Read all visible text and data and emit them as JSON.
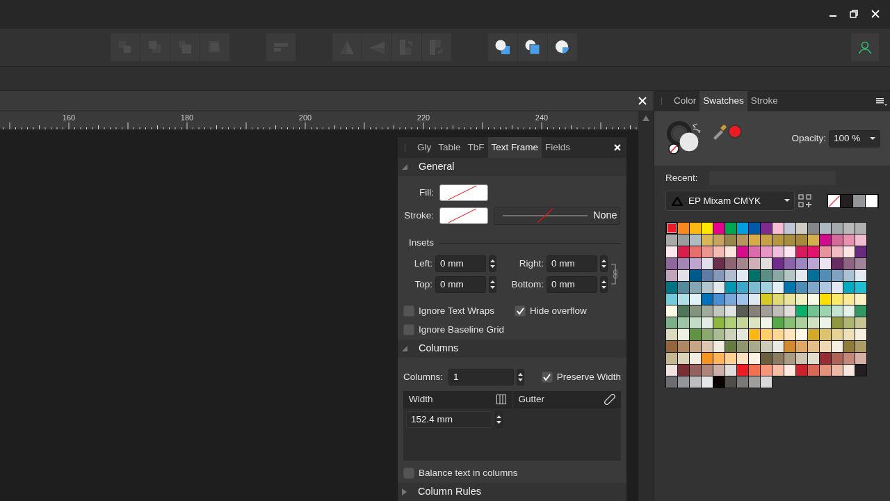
{
  "toolbar": {
    "groups": [
      {
        "buttons": [
          {
            "kind": "bring-to-front",
            "disabled": true
          },
          {
            "kind": "bring-forward",
            "disabled": true
          },
          {
            "kind": "send-backward",
            "disabled": true
          },
          {
            "kind": "send-to-back",
            "disabled": true
          }
        ]
      },
      {
        "buttons": [
          {
            "kind": "align",
            "disabled": true
          }
        ]
      },
      {
        "buttons": [
          {
            "kind": "flip-horizontal",
            "disabled": true
          },
          {
            "kind": "flip-vertical",
            "disabled": true
          },
          {
            "kind": "rotate-left",
            "disabled": true
          },
          {
            "kind": "rotate-right",
            "disabled": true
          }
        ]
      },
      {
        "buttons": [
          {
            "kind": "add",
            "disabled": false
          },
          {
            "kind": "subtract",
            "disabled": false
          },
          {
            "kind": "intersect",
            "disabled": false
          }
        ]
      }
    ]
  },
  "ruler": {
    "labels": [
      "160",
      "180",
      "200",
      "220",
      "240"
    ]
  },
  "text_frame_panel": {
    "tabs": [
      {
        "label": "Gly",
        "selected": false
      },
      {
        "label": "Table",
        "selected": false
      },
      {
        "label": "TbF",
        "selected": false
      },
      {
        "label": "Text Frame",
        "selected": true
      },
      {
        "label": "Fields",
        "selected": false
      }
    ],
    "general": {
      "title": "General",
      "expanded": true,
      "fill_label": "Fill:",
      "stroke_label": "Stroke:",
      "stroke_style": "None",
      "insets_title": "Insets",
      "insets": [
        {
          "label": "Left:",
          "value": "0 mm"
        },
        {
          "label": "Right:",
          "value": "0 mm"
        },
        {
          "label": "Top:",
          "value": "0 mm"
        },
        {
          "label": "Bottom:",
          "value": "0 mm"
        }
      ],
      "options": [
        {
          "label": "Ignore Text Wraps",
          "checked": false
        },
        {
          "label": "Hide overflow",
          "checked": true
        },
        {
          "label": "Ignore Baseline Grid",
          "checked": false
        }
      ]
    },
    "columns": {
      "title": "Columns",
      "expanded": true,
      "count_label": "Columns:",
      "count": "1",
      "preserve_width": {
        "label": "Preserve Width",
        "checked": true
      },
      "table": {
        "columns": [
          "Width",
          "Gutter"
        ],
        "rows": [
          {
            "width": "152.4 mm"
          }
        ]
      },
      "balance": {
        "label": "Balance text in columns",
        "checked": false
      }
    },
    "column_rules": {
      "title": "Column Rules",
      "expanded": false
    }
  },
  "swatches_panel": {
    "tabs": [
      {
        "label": "Color",
        "selected": false
      },
      {
        "label": "Swatches",
        "selected": true
      },
      {
        "label": "Stroke",
        "selected": false
      }
    ],
    "opacity": {
      "label": "Opacity:",
      "value": "100 %"
    },
    "recent": {
      "label": "Recent:"
    },
    "palette": {
      "name": "EP Mixam CMYK"
    },
    "quick_swatches": [
      {
        "kind": "none"
      },
      {
        "kind": "color",
        "color": "#231f20"
      },
      {
        "kind": "color",
        "color": "#939598"
      },
      {
        "kind": "color",
        "color": "#ffffff"
      }
    ],
    "swatch_rows": [
      {
        "swatches": [
          {
            "color": "#ed1c24",
            "selected": true
          },
          {
            "color": "#f7891f",
            "selected": false
          },
          {
            "color": "#fdb813",
            "selected": false
          },
          {
            "color": "#ffe600",
            "selected": false
          },
          {
            "color": "#e0078c",
            "selected": false
          },
          {
            "color": "#00a650",
            "selected": false
          },
          {
            "color": "#009fe0",
            "selected": false
          },
          {
            "color": "#0058a8",
            "selected": false
          },
          {
            "color": "#7f2a8e",
            "selected": false
          },
          {
            "color": "#f7bcd6",
            "selected": false
          },
          {
            "color": "#c0c6d6",
            "selected": false
          },
          {
            "color": "#d0ccc4",
            "selected": false
          },
          {
            "color": "#85868a",
            "selected": false
          },
          {
            "color": "#adb9c1",
            "selected": false
          },
          {
            "color": "#a4a9ab",
            "selected": false
          },
          {
            "color": "#b9b9b9",
            "selected": false
          },
          {
            "color": "#b0b0b0",
            "selected": false
          }
        ]
      },
      {
        "swatches": [
          {
            "color": "#a9a9a9",
            "selected": false
          },
          {
            "color": "#9c9c9c",
            "selected": false
          },
          {
            "color": "#aebbc2",
            "selected": false
          },
          {
            "color": "#dcb654",
            "selected": false
          },
          {
            "color": "#c6a45e",
            "selected": false
          },
          {
            "color": "#98864b",
            "selected": false
          },
          {
            "color": "#b5965c",
            "selected": false
          },
          {
            "color": "#d9ab48",
            "selected": false
          },
          {
            "color": "#c6a244",
            "selected": false
          },
          {
            "color": "#b59741",
            "selected": false
          },
          {
            "color": "#a88c3f",
            "selected": false
          },
          {
            "color": "#a8893a",
            "selected": false
          },
          {
            "color": "#d3b04e",
            "selected": false
          },
          {
            "color": "#d20a8d",
            "selected": false
          },
          {
            "color": "#d36c9a",
            "selected": false
          },
          {
            "color": "#e891b0",
            "selected": false
          },
          {
            "color": "#f1bdd0",
            "selected": false
          }
        ]
      },
      {
        "swatches": [
          {
            "color": "#fde8ef",
            "selected": false
          },
          {
            "color": "#da1e4b",
            "selected": false
          },
          {
            "color": "#e66f6f",
            "selected": false
          },
          {
            "color": "#eb958e",
            "selected": false
          },
          {
            "color": "#f3bdb5",
            "selected": false
          },
          {
            "color": "#fde6dd",
            "selected": false
          },
          {
            "color": "#d70c8c",
            "selected": false
          },
          {
            "color": "#dc6aac",
            "selected": false
          },
          {
            "color": "#e896c6",
            "selected": false
          },
          {
            "color": "#f0bfdb",
            "selected": false
          },
          {
            "color": "#fde8f2",
            "selected": false
          },
          {
            "color": "#d91b5c",
            "selected": false
          },
          {
            "color": "#e0156b",
            "selected": false
          },
          {
            "color": "#e8949e",
            "selected": false
          },
          {
            "color": "#f1bcc4",
            "selected": false
          },
          {
            "color": "#fde6e7",
            "selected": false
          },
          {
            "color": "#682c7e",
            "selected": false
          }
        ]
      },
      {
        "swatches": [
          {
            "color": "#8f679d",
            "selected": false
          },
          {
            "color": "#a386b6",
            "selected": false
          },
          {
            "color": "#bea5cd",
            "selected": false
          },
          {
            "color": "#e0dfeb",
            "selected": false
          },
          {
            "color": "#6a2f4c",
            "selected": false
          },
          {
            "color": "#8f6473",
            "selected": false
          },
          {
            "color": "#a5868c",
            "selected": false
          },
          {
            "color": "#ceb1b8",
            "selected": false
          },
          {
            "color": "#e1dddc",
            "selected": false
          },
          {
            "color": "#702b8d",
            "selected": false
          },
          {
            "color": "#8b63ab",
            "selected": false
          },
          {
            "color": "#9c88c0",
            "selected": false
          },
          {
            "color": "#bba6d3",
            "selected": false
          },
          {
            "color": "#ece3f2",
            "selected": false
          },
          {
            "color": "#672c63",
            "selected": false
          },
          {
            "color": "#8e6482",
            "selected": false
          },
          {
            "color": "#a08399",
            "selected": false
          }
        ]
      },
      {
        "swatches": [
          {
            "color": "#c1a4bb",
            "selected": false
          },
          {
            "color": "#e1dfe8",
            "selected": false
          },
          {
            "color": "#005a8c",
            "selected": false
          },
          {
            "color": "#5f7aa5",
            "selected": false
          },
          {
            "color": "#8698ba",
            "selected": false
          },
          {
            "color": "#b2bdd3",
            "selected": false
          },
          {
            "color": "#e3e9f2",
            "selected": false
          },
          {
            "color": "#007168",
            "selected": false
          },
          {
            "color": "#5b8e86",
            "selected": false
          },
          {
            "color": "#89a7a5",
            "selected": false
          },
          {
            "color": "#b4c5c6",
            "selected": false
          },
          {
            "color": "#e3e9ec",
            "selected": false
          },
          {
            "color": "#006f9a",
            "selected": false
          },
          {
            "color": "#4f8eb5",
            "selected": false
          },
          {
            "color": "#7ea3c0",
            "selected": false
          },
          {
            "color": "#adc1d4",
            "selected": false
          },
          {
            "color": "#e3eaf2",
            "selected": false
          }
        ]
      },
      {
        "swatches": [
          {
            "color": "#007384",
            "selected": false
          },
          {
            "color": "#538b9a",
            "selected": false
          },
          {
            "color": "#84a7b3",
            "selected": false
          },
          {
            "color": "#b1c6cd",
            "selected": false
          },
          {
            "color": "#e3eaee",
            "selected": false
          },
          {
            "color": "#0097b3",
            "selected": false
          },
          {
            "color": "#3ba8c7",
            "selected": false
          },
          {
            "color": "#7bbcd0",
            "selected": false
          },
          {
            "color": "#a3d1de",
            "selected": false
          },
          {
            "color": "#e2f0f5",
            "selected": false
          },
          {
            "color": "#0076ae",
            "selected": false
          },
          {
            "color": "#4c8cb7",
            "selected": false
          },
          {
            "color": "#7ea7ca",
            "selected": false
          },
          {
            "color": "#aec6df",
            "selected": false
          },
          {
            "color": "#e2e9f4",
            "selected": false
          },
          {
            "color": "#00aac0",
            "selected": false
          },
          {
            "color": "#1ec0d1",
            "selected": false
          }
        ]
      },
      {
        "swatches": [
          {
            "color": "#73cbd9",
            "selected": false
          },
          {
            "color": "#aee0e6",
            "selected": false
          },
          {
            "color": "#e2f3f7",
            "selected": false
          },
          {
            "color": "#0072bc",
            "selected": false
          },
          {
            "color": "#4a8fcf",
            "selected": false
          },
          {
            "color": "#7aa8da",
            "selected": false
          },
          {
            "color": "#a2c3e8",
            "selected": false
          },
          {
            "color": "#e0e8f6",
            "selected": false
          },
          {
            "color": "#d4cc24",
            "selected": false
          },
          {
            "color": "#e0dc72",
            "selected": false
          },
          {
            "color": "#ebe49c",
            "selected": false
          },
          {
            "color": "#f1eec2",
            "selected": false
          },
          {
            "color": "#fafbe6",
            "selected": false
          },
          {
            "color": "#ffdd00",
            "selected": false
          },
          {
            "color": "#fee96c",
            "selected": false
          },
          {
            "color": "#feea99",
            "selected": false
          },
          {
            "color": "#fff3c4",
            "selected": false
          }
        ]
      },
      {
        "swatches": [
          {
            "color": "#fffbe7",
            "selected": false
          },
          {
            "color": "#4e775a",
            "selected": false
          },
          {
            "color": "#83957f",
            "selected": false
          },
          {
            "color": "#a0ab9b",
            "selected": false
          },
          {
            "color": "#c2c8bf",
            "selected": false
          },
          {
            "color": "#e1e5df",
            "selected": false
          },
          {
            "color": "#595e55",
            "selected": false
          },
          {
            "color": "#878079",
            "selected": false
          },
          {
            "color": "#a29f98",
            "selected": false
          },
          {
            "color": "#c2bfb8",
            "selected": false
          },
          {
            "color": "#e1dedc",
            "selected": false
          },
          {
            "color": "#08b06a",
            "selected": false
          },
          {
            "color": "#72c394",
            "selected": false
          },
          {
            "color": "#9bd4ae",
            "selected": false
          },
          {
            "color": "#c3e4d0",
            "selected": false
          },
          {
            "color": "#e4f3e9",
            "selected": false
          },
          {
            "color": "#339862",
            "selected": false
          }
        ]
      },
      {
        "swatches": [
          {
            "color": "#7baf8b",
            "selected": false
          },
          {
            "color": "#9fc5a7",
            "selected": false
          },
          {
            "color": "#c3dcc8",
            "selected": false
          },
          {
            "color": "#e3ede5",
            "selected": false
          },
          {
            "color": "#8db73e",
            "selected": false
          },
          {
            "color": "#b0d076",
            "selected": false
          },
          {
            "color": "#c7d59c",
            "selected": false
          },
          {
            "color": "#dbe5c3",
            "selected": false
          },
          {
            "color": "#f1f6e9",
            "selected": false
          },
          {
            "color": "#57a846",
            "selected": false
          },
          {
            "color": "#88bf74",
            "selected": false
          },
          {
            "color": "#acd19a",
            "selected": false
          },
          {
            "color": "#d0e2c2",
            "selected": false
          },
          {
            "color": "#ecf3e8",
            "selected": false
          },
          {
            "color": "#8f973f",
            "selected": false
          },
          {
            "color": "#aeb56f",
            "selected": false
          },
          {
            "color": "#c5c693",
            "selected": false
          }
        ]
      },
      {
        "swatches": [
          {
            "color": "#dcd9bd",
            "selected": false
          },
          {
            "color": "#eef0e3",
            "selected": false
          },
          {
            "color": "#629344",
            "selected": false
          },
          {
            "color": "#8ba96d",
            "selected": false
          },
          {
            "color": "#abbb93",
            "selected": false
          },
          {
            "color": "#cdd3bb",
            "selected": false
          },
          {
            "color": "#e3e6dd",
            "selected": false
          },
          {
            "color": "#fdb714",
            "selected": false
          },
          {
            "color": "#fecf64",
            "selected": false
          },
          {
            "color": "#fed890",
            "selected": false
          },
          {
            "color": "#fee5bb",
            "selected": false
          },
          {
            "color": "#fef6e6",
            "selected": false
          },
          {
            "color": "#d3a929",
            "selected": false
          },
          {
            "color": "#ddc46c",
            "selected": false
          },
          {
            "color": "#e6d394",
            "selected": false
          },
          {
            "color": "#f0e0b7",
            "selected": false
          },
          {
            "color": "#f7efe0",
            "selected": false
          }
        ]
      },
      {
        "swatches": [
          {
            "color": "#95663c",
            "selected": false
          },
          {
            "color": "#b08763",
            "selected": false
          },
          {
            "color": "#c9a587",
            "selected": false
          },
          {
            "color": "#dcc5b1",
            "selected": false
          },
          {
            "color": "#f0ece3",
            "selected": false
          },
          {
            "color": "#677a42",
            "selected": false
          },
          {
            "color": "#8e9570",
            "selected": false
          },
          {
            "color": "#a9ac8b",
            "selected": false
          },
          {
            "color": "#ccccb9",
            "selected": false
          },
          {
            "color": "#e9e9e2",
            "selected": false
          },
          {
            "color": "#d38a2f",
            "selected": false
          },
          {
            "color": "#dea866",
            "selected": false
          },
          {
            "color": "#e5bd8b",
            "selected": false
          },
          {
            "color": "#f0d7b4",
            "selected": false
          },
          {
            "color": "#f7efe1",
            "selected": false
          },
          {
            "color": "#8f7c3a",
            "selected": false
          },
          {
            "color": "#ad9b68",
            "selected": false
          }
        ]
      },
      {
        "swatches": [
          {
            "color": "#c5b792",
            "selected": false
          },
          {
            "color": "#dcd2b7",
            "selected": false
          },
          {
            "color": "#f1ede2",
            "selected": false
          },
          {
            "color": "#f8931f",
            "selected": false
          },
          {
            "color": "#feb65b",
            "selected": false
          },
          {
            "color": "#fdd18e",
            "selected": false
          },
          {
            "color": "#fee1c1",
            "selected": false
          },
          {
            "color": "#fef2e5",
            "selected": false
          },
          {
            "color": "#6b5e3e",
            "selected": false
          },
          {
            "color": "#8c7c5f",
            "selected": false
          },
          {
            "color": "#aa9c84",
            "selected": false
          },
          {
            "color": "#cfc5b3",
            "selected": false
          },
          {
            "color": "#e3ddcf",
            "selected": false
          },
          {
            "color": "#962d32",
            "selected": false
          },
          {
            "color": "#ad6457",
            "selected": false
          },
          {
            "color": "#c4887b",
            "selected": false
          },
          {
            "color": "#d7b0a5",
            "selected": false
          }
        ]
      },
      {
        "swatches": [
          {
            "color": "#f0e3e2",
            "selected": false
          },
          {
            "color": "#7a2f35",
            "selected": false
          },
          {
            "color": "#94625e",
            "selected": false
          },
          {
            "color": "#ad8579",
            "selected": false
          },
          {
            "color": "#cdb0a8",
            "selected": false
          },
          {
            "color": "#e3ddd9",
            "selected": false
          },
          {
            "color": "#ed1c24",
            "selected": false
          },
          {
            "color": "#f47051",
            "selected": false
          },
          {
            "color": "#f7977a",
            "selected": false
          },
          {
            "color": "#fbbea4",
            "selected": false
          },
          {
            "color": "#feeae0",
            "selected": false
          },
          {
            "color": "#cc2229",
            "selected": false
          },
          {
            "color": "#d86856",
            "selected": false
          },
          {
            "color": "#e29279",
            "selected": false
          },
          {
            "color": "#ecb9a5",
            "selected": false
          },
          {
            "color": "#f8e6df",
            "selected": false
          },
          {
            "color": "#231f20",
            "selected": false
          }
        ]
      },
      {
        "swatches": [
          {
            "color": "#6d6e71",
            "selected": false
          },
          {
            "color": "#939598",
            "selected": false
          },
          {
            "color": "#bcbec0",
            "selected": false
          },
          {
            "color": "#e6e7e8",
            "selected": false
          },
          {
            "color": "#0b0203",
            "selected": false
          },
          {
            "color": "#504c4a",
            "selected": false
          },
          {
            "color": "#7b7978",
            "selected": false
          },
          {
            "color": "#a09e9c",
            "selected": false
          },
          {
            "color": "#d9d9d9",
            "selected": false
          }
        ]
      }
    ]
  }
}
